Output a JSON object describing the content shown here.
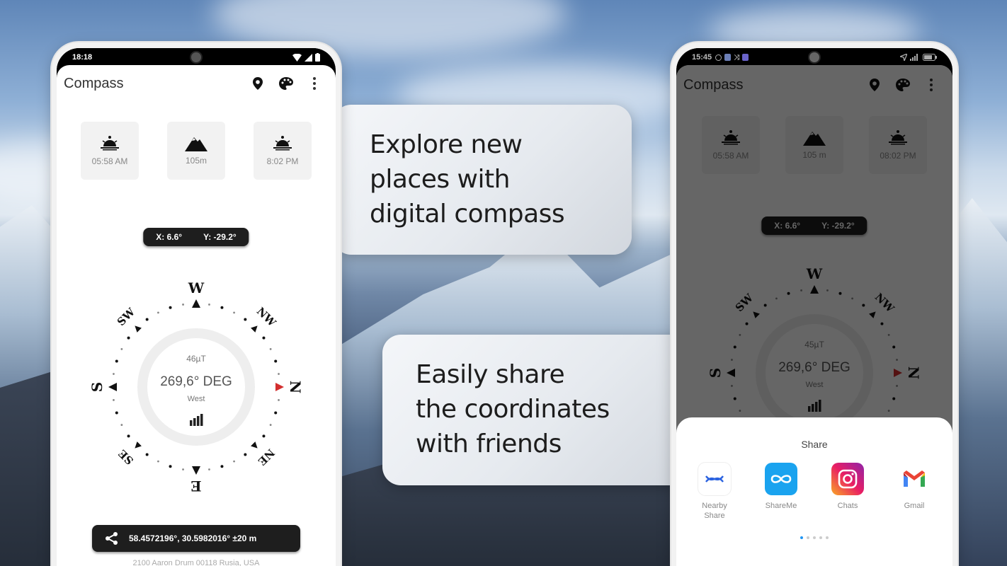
{
  "promo": {
    "headline_1": [
      "Explore new",
      "places with",
      "digital compass"
    ],
    "headline_2": [
      "Easily share",
      "the coordinates",
      "with  friends"
    ]
  },
  "left_phone": {
    "status": {
      "time": "18:18",
      "icons": [
        "wifi-icon",
        "signal-icon",
        "battery-icon"
      ]
    },
    "appbar": {
      "title": "Compass",
      "actions": [
        "location-pin-icon",
        "palette-icon",
        "more-vert-icon"
      ]
    },
    "cards": [
      {
        "icon": "sunrise-icon",
        "value": "05:58 AM"
      },
      {
        "icon": "mountain-icon",
        "value": "105m"
      },
      {
        "icon": "sunset-icon",
        "value": "8:02 PM"
      }
    ],
    "tilt": {
      "x": "X: 6.6°",
      "y": "Y: -29.2°"
    },
    "compass": {
      "heading_deg": 269.6,
      "field": "46µT",
      "reading": "269,6° DEG",
      "direction": "West",
      "labels": {
        "top": "W",
        "top_right": "NW",
        "right": "N",
        "bottom_right": "NE",
        "bottom": "E",
        "bottom_left": "SE",
        "left": "S",
        "top_left": "SW"
      },
      "accent": "#d32f2f"
    },
    "coordinates": "58.4572196°, 30.5982016° ±20 m",
    "address": "2100 Aaron Drum 00118 Rusia, USA"
  },
  "right_phone": {
    "status": {
      "time": "15:45"
    },
    "appbar": {
      "title": "Compass"
    },
    "cards": [
      {
        "icon": "sunrise-icon",
        "value": "05:58 AM"
      },
      {
        "icon": "mountain-icon",
        "value": "105 m"
      },
      {
        "icon": "sunset-icon",
        "value": "08:02 PM"
      }
    ],
    "tilt": {
      "x": "X: 6.6°",
      "y": "Y: -29.2°"
    },
    "compass": {
      "field": "45µT",
      "reading": "269,6° DEG",
      "direction": "West",
      "labels": {
        "top": "W",
        "top_right": "NW",
        "right": "N",
        "left": "S",
        "top_left": "SW"
      }
    },
    "share": {
      "title": "Share",
      "apps": [
        {
          "name": "Nearby Share",
          "icon": "nearby-share-icon"
        },
        {
          "name": "ShareMe",
          "icon": "shareme-icon"
        },
        {
          "name": "Chats",
          "icon": "instagram-icon"
        },
        {
          "name": "Gmail",
          "icon": "gmail-icon"
        }
      ],
      "page_count": 5,
      "current_page": 1
    }
  }
}
